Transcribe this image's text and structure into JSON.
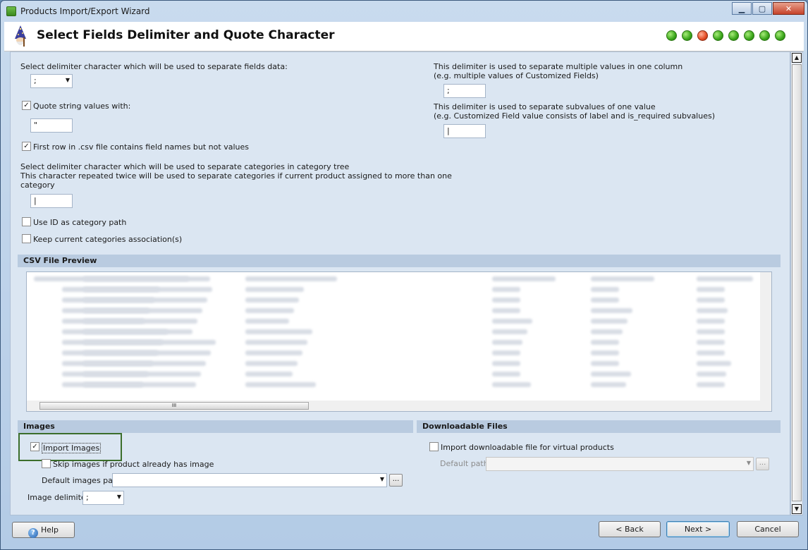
{
  "window": {
    "title": "Products Import/Export Wizard",
    "minimize": "▁",
    "maximize": "▢",
    "close": "✕"
  },
  "header": {
    "title": "Select Fields Delimiter and Quote Character",
    "steps": [
      "done",
      "done",
      "current",
      "done",
      "done",
      "done",
      "done",
      "done"
    ]
  },
  "fields": {
    "delimiter_label": "Select delimiter character which will be used to separate fields data:",
    "delimiter_value": ";",
    "quote_label": "Quote string values with:",
    "quote_checked": true,
    "quote_value": "\"",
    "first_row_label": "First row in .csv file contains field names but not values",
    "first_row_checked": true,
    "category_delim_line1": "Select delimiter character which will be used to separate categories in category tree",
    "category_delim_line2": "This character repeated twice will be used to separate categories if current product assigned to more than one",
    "category_delim_line3": "category",
    "category_delim_value": "|",
    "use_id_label": "Use ID as category path",
    "use_id_checked": false,
    "keep_assoc_label": "Keep current categories association(s)",
    "keep_assoc_checked": false
  },
  "right_fields": {
    "multi_line1": "This delimiter is used to separate multiple values in one column",
    "multi_line2": "(e.g. multiple values of Customized Fields)",
    "multi_value": ";",
    "sub_line1": "This delimiter is used to separate subvalues of one value",
    "sub_line2": "(e.g. Customized Field value consists of label and is_required subvalues)",
    "sub_value": "|"
  },
  "preview": {
    "title": "CSV File Preview",
    "hthumb_grip": "III"
  },
  "images": {
    "title": "Images",
    "import_label": "Import Images",
    "import_checked": true,
    "skip_label": "Skip images if product already has image",
    "skip_checked": false,
    "path_label": "Default images path",
    "delim_label": "Image delimiter",
    "delim_value": ";",
    "browse_label": "..."
  },
  "downloadable": {
    "title": "Downloadable Files",
    "import_label": "Import downloadable file for virtual products",
    "import_checked": false,
    "path_label": "Default path",
    "browse_label": "..."
  },
  "buttons": {
    "help": "Help",
    "back": "< Back",
    "next": "Next >",
    "cancel": "Cancel"
  },
  "icons": {
    "check": "✓",
    "caret": "▼"
  }
}
